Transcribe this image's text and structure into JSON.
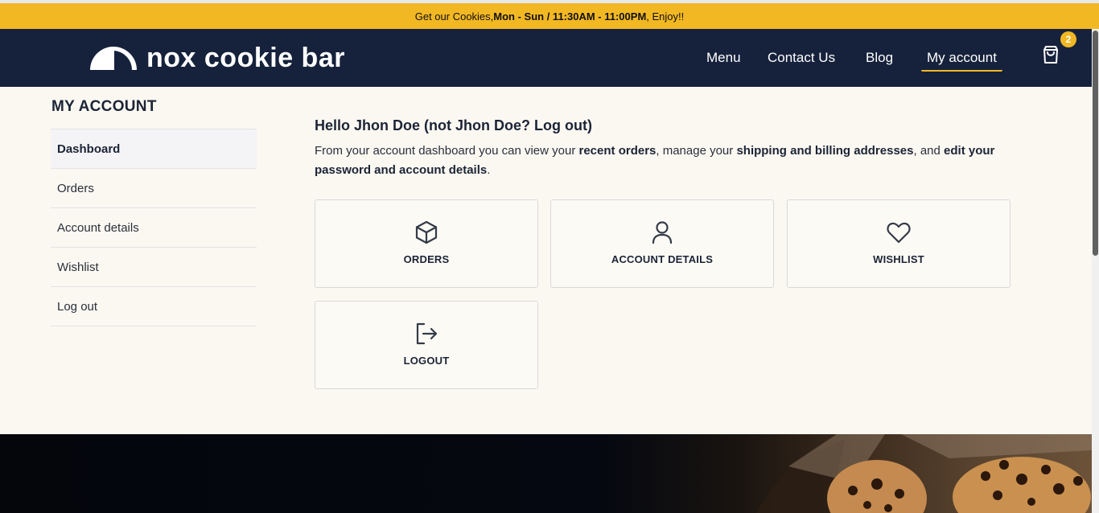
{
  "announcement": {
    "prefix": "Get our Cookies, ",
    "hours": "Mon - Sun / 11:30AM - 11:00PM",
    "suffix": ", Enjoy!!"
  },
  "brand": {
    "name": "nox cookie bar"
  },
  "nav": {
    "items": [
      "Menu",
      "Contact Us",
      "Blog",
      "My account"
    ],
    "active": "My account",
    "cart_count": "2"
  },
  "sidebar": {
    "title": "MY ACCOUNT",
    "items": [
      "Dashboard",
      "Orders",
      "Account details",
      "Wishlist",
      "Log out"
    ],
    "active": "Dashboard"
  },
  "main": {
    "greeting": "Hello Jhon Doe (not Jhon Doe? Log out)",
    "intro": {
      "part1": "From your account dashboard you can view your ",
      "recent_orders": "recent orders",
      "part2": ", manage your ",
      "addresses": "shipping and billing addresses",
      "part3": ", and ",
      "edit": "edit your password and account details",
      "part4": "."
    },
    "cards": [
      {
        "label": "ORDERS",
        "icon": "box-icon"
      },
      {
        "label": "ACCOUNT DETAILS",
        "icon": "user-icon"
      },
      {
        "label": "WISHLIST",
        "icon": "heart-icon"
      },
      {
        "label": "LOGOUT",
        "icon": "logout-icon"
      }
    ]
  },
  "colors": {
    "accent": "#f2b823",
    "navbar": "#16223c",
    "background": "#fbf8f2"
  }
}
